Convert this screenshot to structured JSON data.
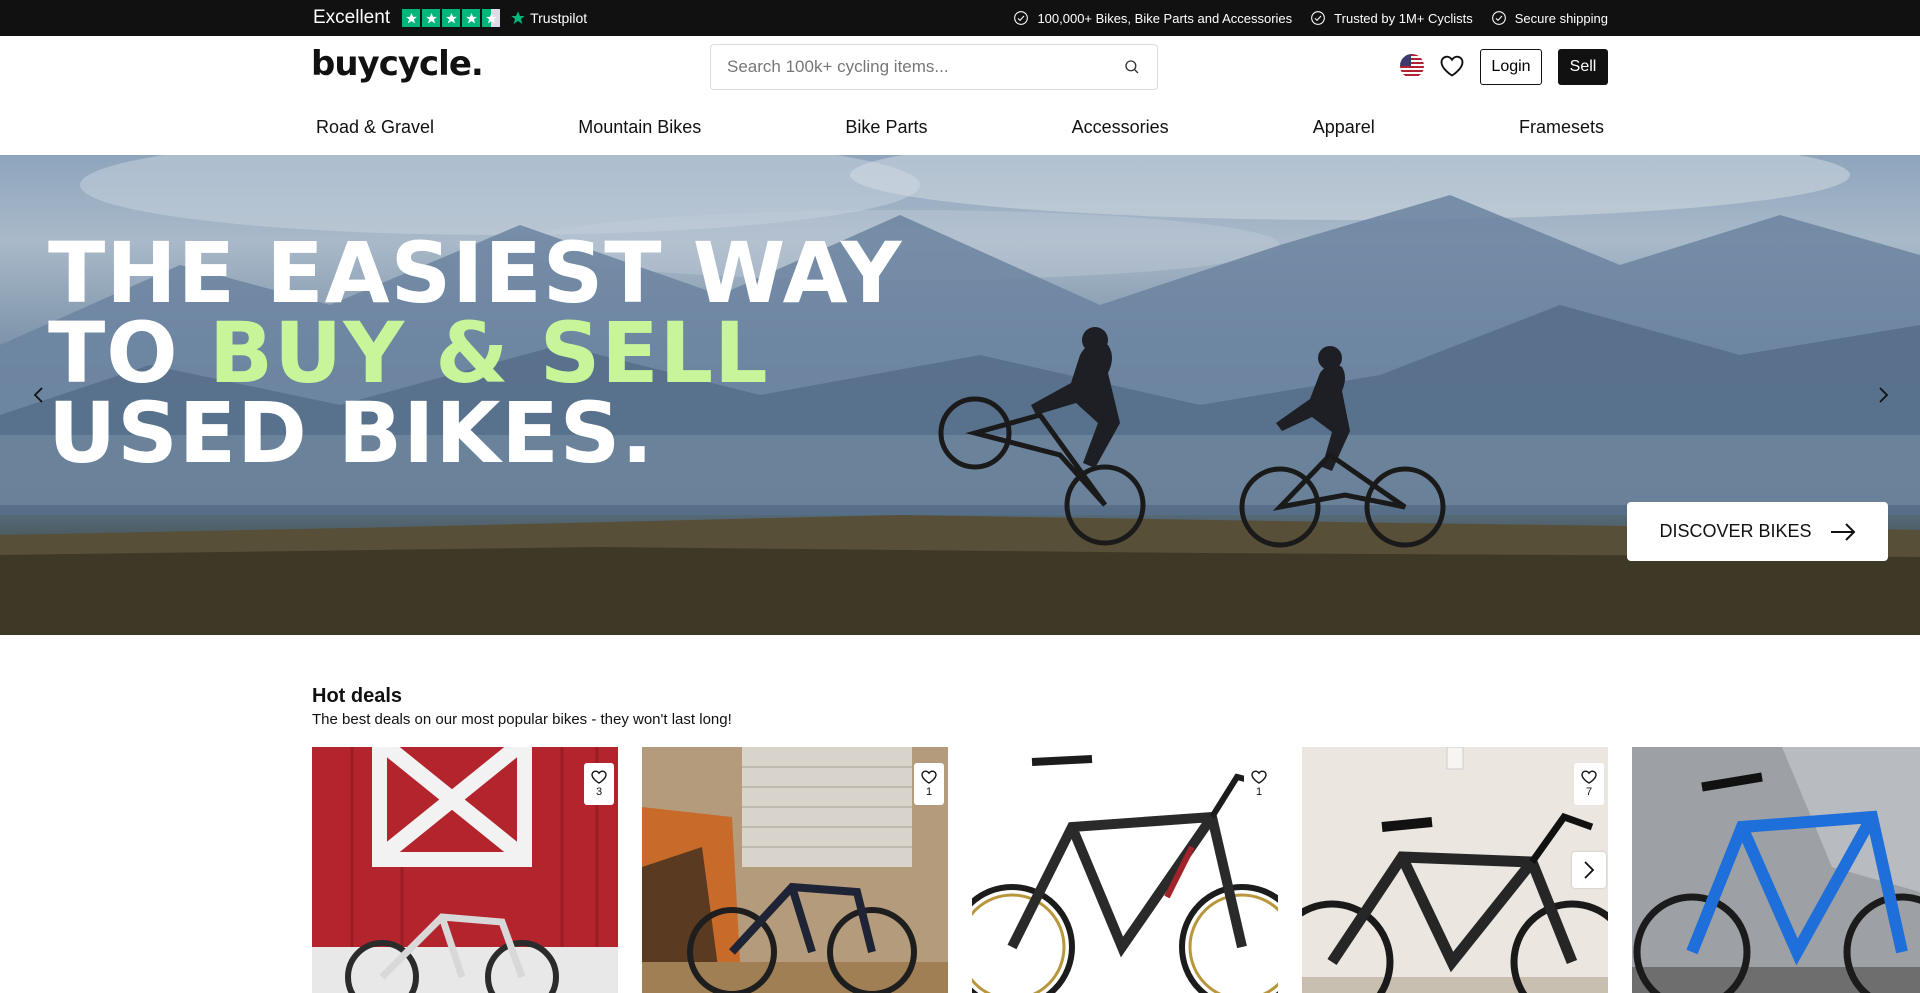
{
  "topbar": {
    "rating_label": "Excellent",
    "rating_stars": 4.5,
    "trustpilot_label": "Trustpilot",
    "usps": [
      "100,000+ Bikes, Bike Parts and Accessories",
      "Trusted by 1M+ Cyclists",
      "Secure shipping"
    ]
  },
  "header": {
    "logo": "buycycle.",
    "search_placeholder": "Search 100k+ cycling items...",
    "login_label": "Login",
    "sell_label": "Sell",
    "flag_icon": "us-flag-icon",
    "wishlist_icon": "heart-icon"
  },
  "nav": {
    "items": [
      "Road & Gravel",
      "Mountain Bikes",
      "Bike Parts",
      "Accessories",
      "Apparel",
      "Framesets"
    ]
  },
  "hero": {
    "line1": "THE EASIEST WAY",
    "line2_prefix": "TO ",
    "line2_accent": "BUY & SELL",
    "line3": "USED BIKES.",
    "accent_color": "#c9f59a",
    "cta_label": "DISCOVER BIKES"
  },
  "deals": {
    "title": "Hot deals",
    "subtitle": "The best deals on our most popular bikes - they won't last long!",
    "cards": [
      {
        "likes": "3"
      },
      {
        "likes": "1"
      },
      {
        "likes": "1"
      },
      {
        "likes": "7"
      },
      {
        "likes": ""
      }
    ]
  }
}
